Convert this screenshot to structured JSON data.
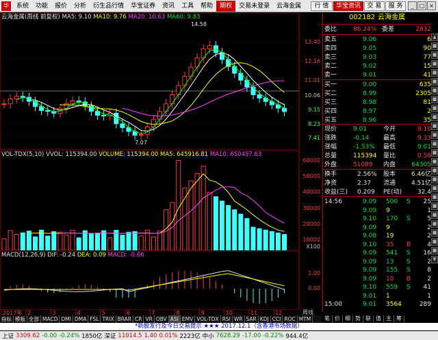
{
  "menu": {
    "items": [
      "系统",
      "功能",
      "报价",
      "分析",
      "衍生品行情",
      "华宝证券",
      "资讯",
      "工具",
      "帮助"
    ],
    "active": "期权",
    "account": "交易未登录",
    "stock_tab": "云海金属",
    "right_buttons": [
      "行 情",
      "华宝资讯",
      "交 易",
      "服 务"
    ]
  },
  "chart": {
    "title_line": {
      "name": "云海金属(周线 前复权)",
      "ma5": "MA5: 9.10",
      "ma10": "MA10: 9.76",
      "ma20": "MA20: 10.63",
      "ma60": "MA60: 9.83"
    },
    "price_labels": [
      "13.40",
      "12.16",
      "11.01",
      "10.06",
      "9.15",
      "8.23",
      "7.41"
    ],
    "high_marker": "14.58",
    "low_marker": "7.07",
    "vol_line": {
      "name": "VOL-TDX(5,10)",
      "vvol": "VVOL: 115394.00",
      "volume": "VOLUME: 115394.00",
      "ma5": "MA5: 645916.81",
      "ma10": "MA10: 650497.63"
    },
    "vol_labels": [
      "60000",
      "50000",
      "40000",
      "30000",
      "20000",
      "10000"
    ],
    "vol_unit": "X100",
    "macd_line": {
      "name": "MACD(12,26,9)",
      "dif": "DIF: -0.24",
      "dea": "DEA: 0.09",
      "macd": "MACD: -0.66"
    },
    "macd_labels": [
      "1.00",
      "0.00"
    ],
    "time_labels": [
      "2017年",
      "2",
      "3",
      "4",
      "5",
      "6",
      "7",
      "8",
      "9",
      "10",
      "11",
      "12"
    ],
    "period_label": "周线",
    "tabs": [
      "指标",
      "模板",
      "全部",
      "MACD",
      "DMI",
      "DMA",
      "FSL",
      "TRIX",
      "BRAR",
      "CR",
      "VR",
      "OBV",
      "ASI",
      "EMV",
      "VOL-TDX",
      "RSI",
      "WR",
      "SAR",
      "KDJ",
      "CCI",
      "ROC",
      "MTM"
    ],
    "bottom_left": [
      "扩展",
      "关联报价"
    ]
  },
  "quote": {
    "code": "002182",
    "name": "云海金属",
    "weibi_label": "委比",
    "weibi": "86.24%",
    "weicha_label": "委差",
    "weicha": "2832",
    "sell": [
      {
        "label": "卖五",
        "price": "9.06",
        "vol": "6"
      },
      {
        "label": "卖四",
        "price": "9.05",
        "vol": "90"
      },
      {
        "label": "卖三",
        "price": "9.03",
        "vol": "77"
      },
      {
        "label": "卖二",
        "price": "9.02",
        "vol": "15"
      },
      {
        "label": "卖一",
        "price": "9.01",
        "vol": "41"
      }
    ],
    "buy": [
      {
        "label": "买一",
        "price": "9.00",
        "vol": "635"
      },
      {
        "label": "买二",
        "price": "8.99",
        "vol": "2305"
      },
      {
        "label": "买三",
        "price": "8.98",
        "vol": "81"
      },
      {
        "label": "买四",
        "price": "8.97",
        "vol": "2"
      },
      {
        "label": "买五",
        "price": "8.96",
        "vol": "35"
      }
    ],
    "stats": [
      {
        "l1": "现价",
        "v1": "9.01",
        "l2": "今开",
        "v2": "9.10"
      },
      {
        "l1": "涨跌",
        "v1": "-0.14",
        "l2": "最高",
        "v2": "9.33"
      },
      {
        "l1": "涨幅",
        "v1": "-1.53%",
        "l2": "最低",
        "v2": "9.01"
      },
      {
        "l1": "总量",
        "v1": "115394",
        "l2": "量比",
        "v2": "0.58"
      },
      {
        "l1": "外盘",
        "v1": "51089",
        "l2": "内盘",
        "v2": "64305"
      }
    ],
    "stats2": [
      {
        "l1": "换手",
        "v1": "2.56%",
        "l2": "股本",
        "v2": "6.46亿"
      },
      {
        "l1": "净资",
        "v1": "2.37",
        "l2": "流通",
        "v2": "4.51亿"
      },
      {
        "l1": "收益(三)",
        "v1": "0.209",
        "l2": "PE(动)",
        "v2": "32.4"
      }
    ],
    "ticks": [
      {
        "t": "14:56",
        "p": "9.09",
        "v": "500",
        "bs": "S",
        "n": "25"
      },
      {
        "t": "",
        "p": "9.09",
        "v": "9",
        "bs": "",
        "n": "1"
      },
      {
        "t": "",
        "p": "9.10",
        "v": "170",
        "bs": "S",
        "n": "5"
      },
      {
        "t": "",
        "p": "9.09",
        "v": "9",
        "bs": "",
        "n": "2"
      },
      {
        "t": "",
        "p": "9.08",
        "v": "19",
        "bs": "",
        "n": "2"
      },
      {
        "t": "",
        "p": "9.10",
        "v": "35",
        "bs": "B",
        "n": "4"
      },
      {
        "t": "",
        "p": "9.09",
        "v": "541",
        "bs": "S",
        "n": "16"
      },
      {
        "t": "",
        "p": "9.09",
        "v": "13",
        "bs": "S",
        "n": "2"
      },
      {
        "t": "",
        "p": "9.09",
        "v": "155",
        "bs": "S",
        "n": "8"
      },
      {
        "t": "",
        "p": "9.09",
        "v": "10",
        "bs": "B",
        "n": "2"
      },
      {
        "t": "",
        "p": "9.10",
        "v": "559",
        "bs": "S",
        "n": "41"
      },
      {
        "t": "",
        "p": "9.01",
        "v": "1",
        "bs": "",
        "n": "1"
      },
      {
        "t": "15:00",
        "p": "9.01",
        "v": "3564",
        "bs": "",
        "n": "289"
      }
    ],
    "bottom_tabs": [
      "笔",
      "价",
      "细",
      "势",
      "联",
      "值",
      "主",
      "筹"
    ]
  },
  "notice": "*新股发行及今日交易提示 ★★★ 2017.12.1（含香港市场数据）",
  "status": {
    "sh": {
      "name": "上证",
      "val": "3309.62",
      "chg": "-0.00",
      "pct": "-0.24%",
      "amt": "1850亿"
    },
    "sz": {
      "name": "深证",
      "val": "11014.5",
      "chg": "1.40",
      "pct": "0.01%",
      "amt": "2223亿"
    },
    "zx": {
      "name": "中小",
      "val": "7628.29",
      "chg": "-17.00",
      "pct": "-0.22%",
      "amt": "944.4亿"
    }
  },
  "colors": {
    "up": "#ff3b3b",
    "down": "#40ffff",
    "ma5": "#ffffff",
    "ma10": "#ffff00",
    "ma20": "#ff40ff",
    "ma60": "#00ff00",
    "accent": "#cc0000"
  }
}
